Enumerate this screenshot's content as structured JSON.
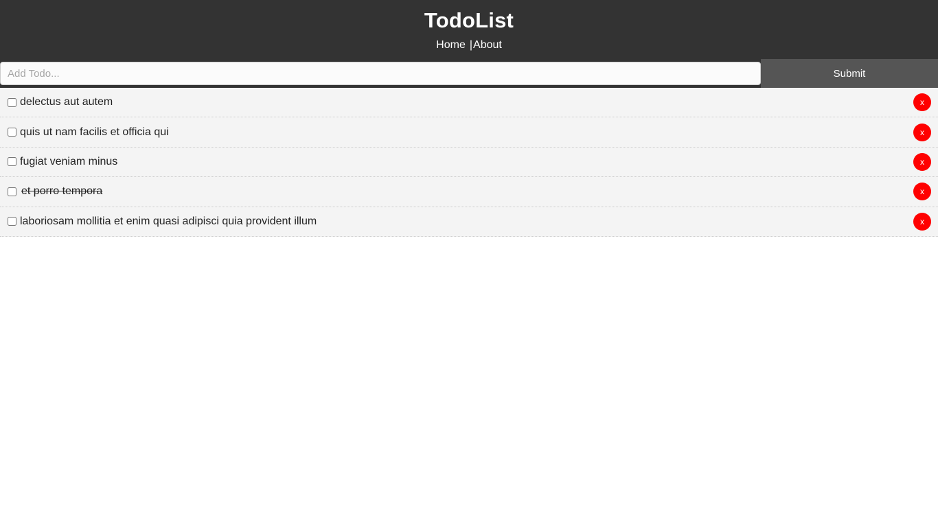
{
  "header": {
    "title": "TodoList",
    "nav": [
      {
        "label": "Home",
        "name": "nav-link-home"
      },
      {
        "label": "About",
        "name": "nav-link-about"
      }
    ],
    "nav_separator": "|",
    "background_color": "#333333",
    "text_color": "#ffffff"
  },
  "form": {
    "input_placeholder": "Add Todo...",
    "input_value": "",
    "submit_label": "Submit",
    "submit_background_color": "#555555"
  },
  "list": {
    "delete_label": "x",
    "delete_color": "#ff0000",
    "row_background_color": "#f4f4f4",
    "items": [
      {
        "text": "delectus aut autem",
        "completed": false
      },
      {
        "text": "quis ut nam facilis et officia qui",
        "completed": false
      },
      {
        "text": "fugiat veniam minus",
        "completed": false
      },
      {
        "text": "et porro tempora",
        "completed": true
      },
      {
        "text": "laboriosam mollitia et enim quasi adipisci quia provident illum",
        "completed": false
      }
    ]
  }
}
